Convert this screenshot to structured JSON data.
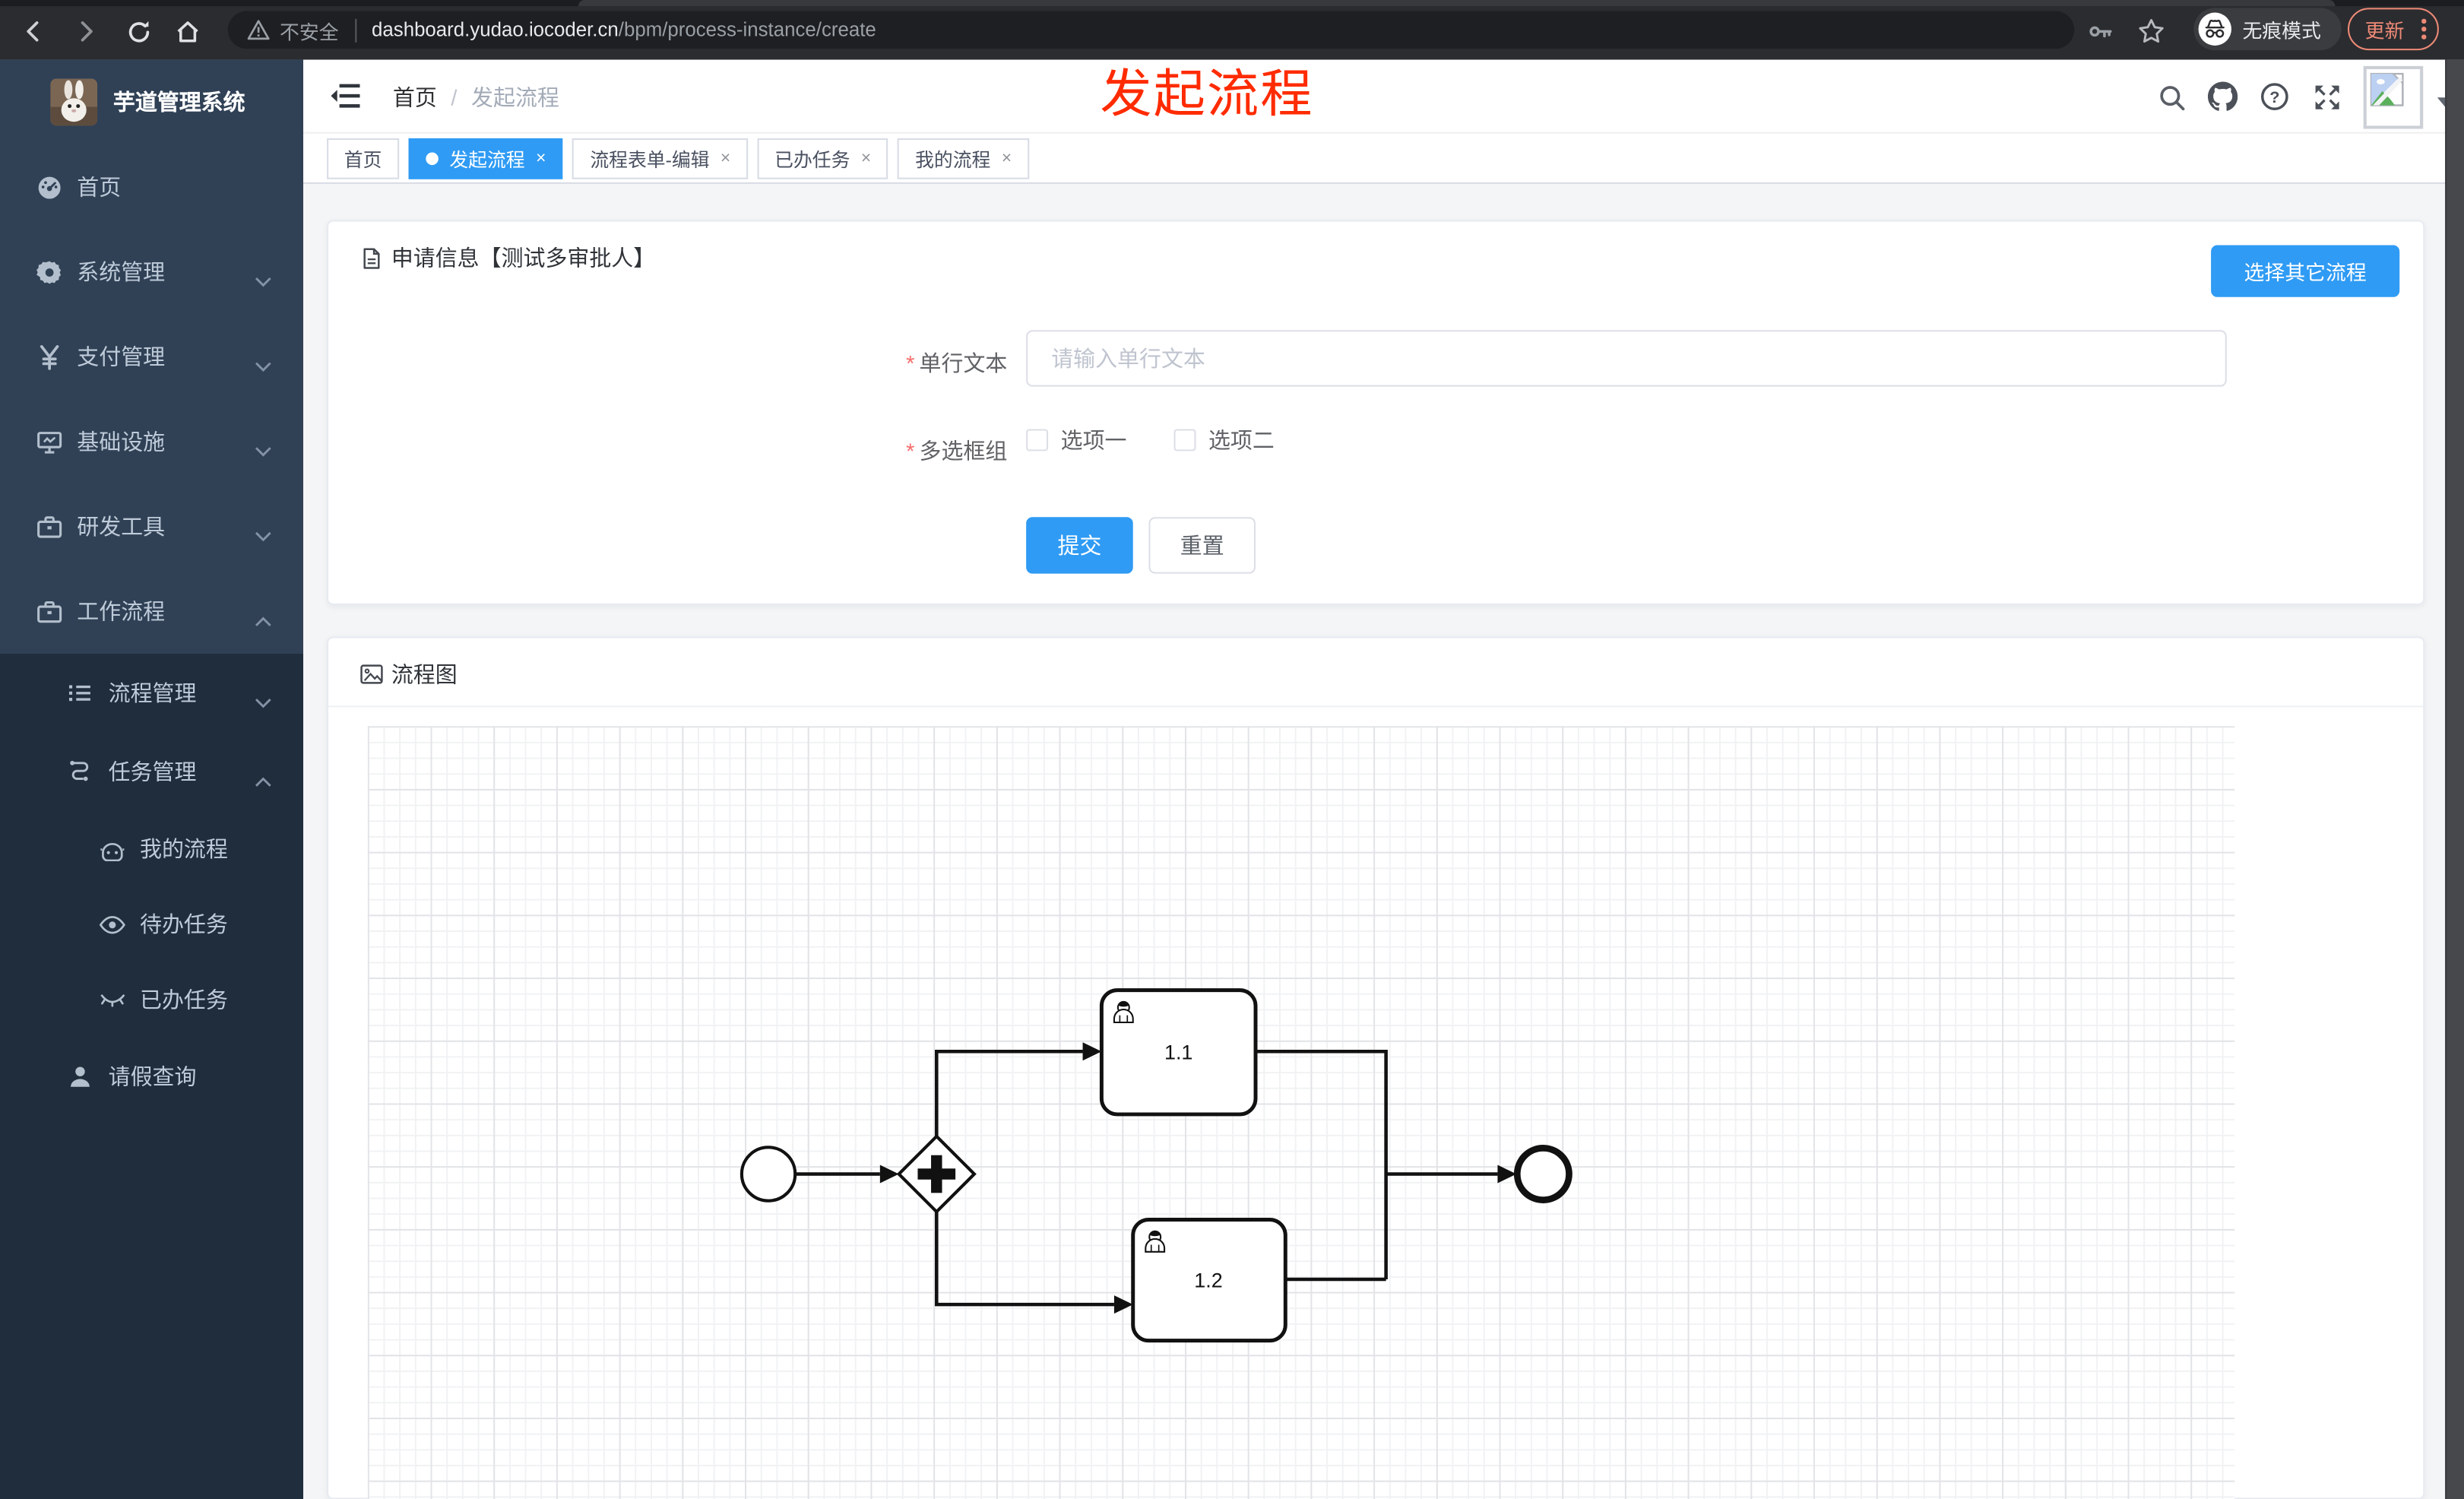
{
  "browser": {
    "security_label": "不安全",
    "url_host": "dashboard.yudao.iocoder.cn",
    "url_path": "/bpm/process-instance/create",
    "incognito_label": "无痕模式",
    "update_label": "更新"
  },
  "sidebar": {
    "title": "芋道管理系统",
    "menu": [
      {
        "label": "首页"
      },
      {
        "label": "系统管理"
      },
      {
        "label": "支付管理"
      },
      {
        "label": "基础设施"
      },
      {
        "label": "研发工具"
      },
      {
        "label": "工作流程"
      }
    ],
    "submenu": [
      {
        "label": "流程管理"
      },
      {
        "label": "任务管理"
      },
      {
        "label": "我的流程"
      },
      {
        "label": "待办任务"
      },
      {
        "label": "已办任务"
      },
      {
        "label": "请假查询"
      }
    ]
  },
  "header": {
    "breadcrumb_home": "首页",
    "separator": "/",
    "breadcrumb_current": "发起流程",
    "annotation": "发起流程"
  },
  "tabs": [
    {
      "label": "首页"
    },
    {
      "label": "发起流程"
    },
    {
      "label": "流程表单-编辑"
    },
    {
      "label": "已办任务"
    },
    {
      "label": "我的流程"
    }
  ],
  "ui": {
    "close_glyph": "×"
  },
  "form_card": {
    "title": "申请信息【测试多审批人】",
    "select_other_button": "选择其它流程",
    "fields": [
      {
        "label": "单行文本",
        "required": true,
        "placeholder": "请输入单行文本",
        "value": ""
      },
      {
        "label": "多选框组",
        "required": true,
        "options": [
          "选项一",
          "选项二"
        ],
        "checked": [
          false,
          false
        ]
      }
    ],
    "submit_label": "提交",
    "reset_label": "重置"
  },
  "flow_card": {
    "title": "流程图",
    "diagram": {
      "type": "bpmn",
      "nodes": [
        {
          "id": "start",
          "type": "startEvent"
        },
        {
          "id": "gateway",
          "type": "parallelGateway"
        },
        {
          "id": "task1",
          "type": "userTask",
          "label": "1.1"
        },
        {
          "id": "task2",
          "type": "userTask",
          "label": "1.2"
        },
        {
          "id": "end",
          "type": "endEvent"
        }
      ],
      "task1_label": "1.1",
      "task2_label": "1.2"
    }
  },
  "colors": {
    "primary": "#2f9bf4",
    "annotation_red": "#ff2b00",
    "sidebar_bg": "#304156",
    "submenu_bg": "#1f2d3d",
    "chrome_bg": "#2b2c2f",
    "update_salmon": "#ee8a77"
  }
}
